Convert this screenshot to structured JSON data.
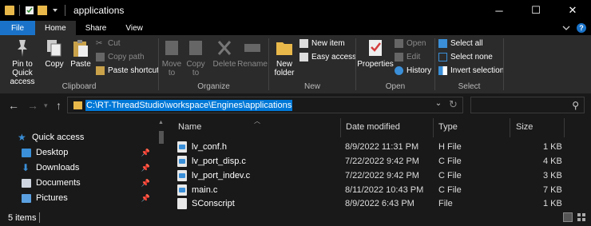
{
  "window": {
    "title": "applications",
    "controls": {
      "minimize": "─",
      "maximize": "☐",
      "close": "✕"
    }
  },
  "tabs": [
    {
      "label": "File"
    },
    {
      "label": "Home"
    },
    {
      "label": "Share"
    },
    {
      "label": "View"
    }
  ],
  "ribbon": {
    "clipboard": {
      "label": "Clipboard",
      "pin_quick_access": "Pin to Quick access",
      "copy": "Copy",
      "paste": "Paste",
      "cut": "Cut",
      "copy_path": "Copy path",
      "paste_shortcut": "Paste shortcut"
    },
    "organize": {
      "label": "Organize",
      "move_to": "Move to",
      "copy_to": "Copy to",
      "delete": "Delete",
      "rename": "Rename"
    },
    "new": {
      "label": "New",
      "new_folder": "New folder",
      "new_item": "New item",
      "easy_access": "Easy access"
    },
    "open": {
      "label": "Open",
      "properties": "Properties",
      "open": "Open",
      "edit": "Edit",
      "history": "History"
    },
    "select": {
      "label": "Select",
      "select_all": "Select all",
      "select_none": "Select none",
      "invert_selection": "Invert selection"
    }
  },
  "address": {
    "path": "C:\\RT-ThreadStudio\\workspace\\Engines\\applications",
    "search_placeholder": ""
  },
  "nav_pane": {
    "items": [
      {
        "label": "Quick access",
        "color": "#3a8fd8"
      },
      {
        "label": "Desktop",
        "color": "#3a8fd8"
      },
      {
        "label": "Downloads",
        "color": "#3a8fd8"
      },
      {
        "label": "Documents",
        "color": "#cfd6df"
      },
      {
        "label": "Pictures",
        "color": "#5aa0e0"
      }
    ]
  },
  "file_list": {
    "columns": [
      "Name",
      "Date modified",
      "Type",
      "Size"
    ],
    "rows": [
      {
        "name": "lv_conf.h",
        "date": "8/9/2022 11:31 PM",
        "type": "H File",
        "size": "1 KB"
      },
      {
        "name": "lv_port_disp.c",
        "date": "7/22/2022 9:42 PM",
        "type": "C File",
        "size": "4 KB"
      },
      {
        "name": "lv_port_indev.c",
        "date": "7/22/2022 9:42 PM",
        "type": "C File",
        "size": "3 KB"
      },
      {
        "name": "main.c",
        "date": "8/11/2022 10:43 PM",
        "type": "C File",
        "size": "7 KB"
      },
      {
        "name": "SConscript",
        "date": "8/9/2022 6:43 PM",
        "type": "File",
        "size": "1 KB"
      }
    ]
  },
  "status": {
    "item_count": "5 items"
  }
}
